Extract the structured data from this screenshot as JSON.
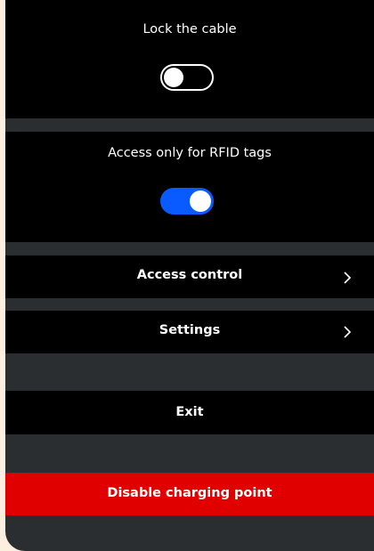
{
  "settings": {
    "lock_cable": {
      "label": "Lock the cable",
      "enabled": false
    },
    "rfid_only": {
      "label": "Access only for RFID tags",
      "enabled": true
    }
  },
  "menu": {
    "access_control": "Access control",
    "settings": "Settings",
    "exit": "Exit",
    "disable": "Disable charging point"
  },
  "colors": {
    "toggle_on": "#0a5bff",
    "danger": "#e00000",
    "panel": "#000000",
    "background": "#2b2e31",
    "page_bg": "#fcefdf"
  },
  "icons": {
    "row_arrow": "chevron-right-icon"
  }
}
